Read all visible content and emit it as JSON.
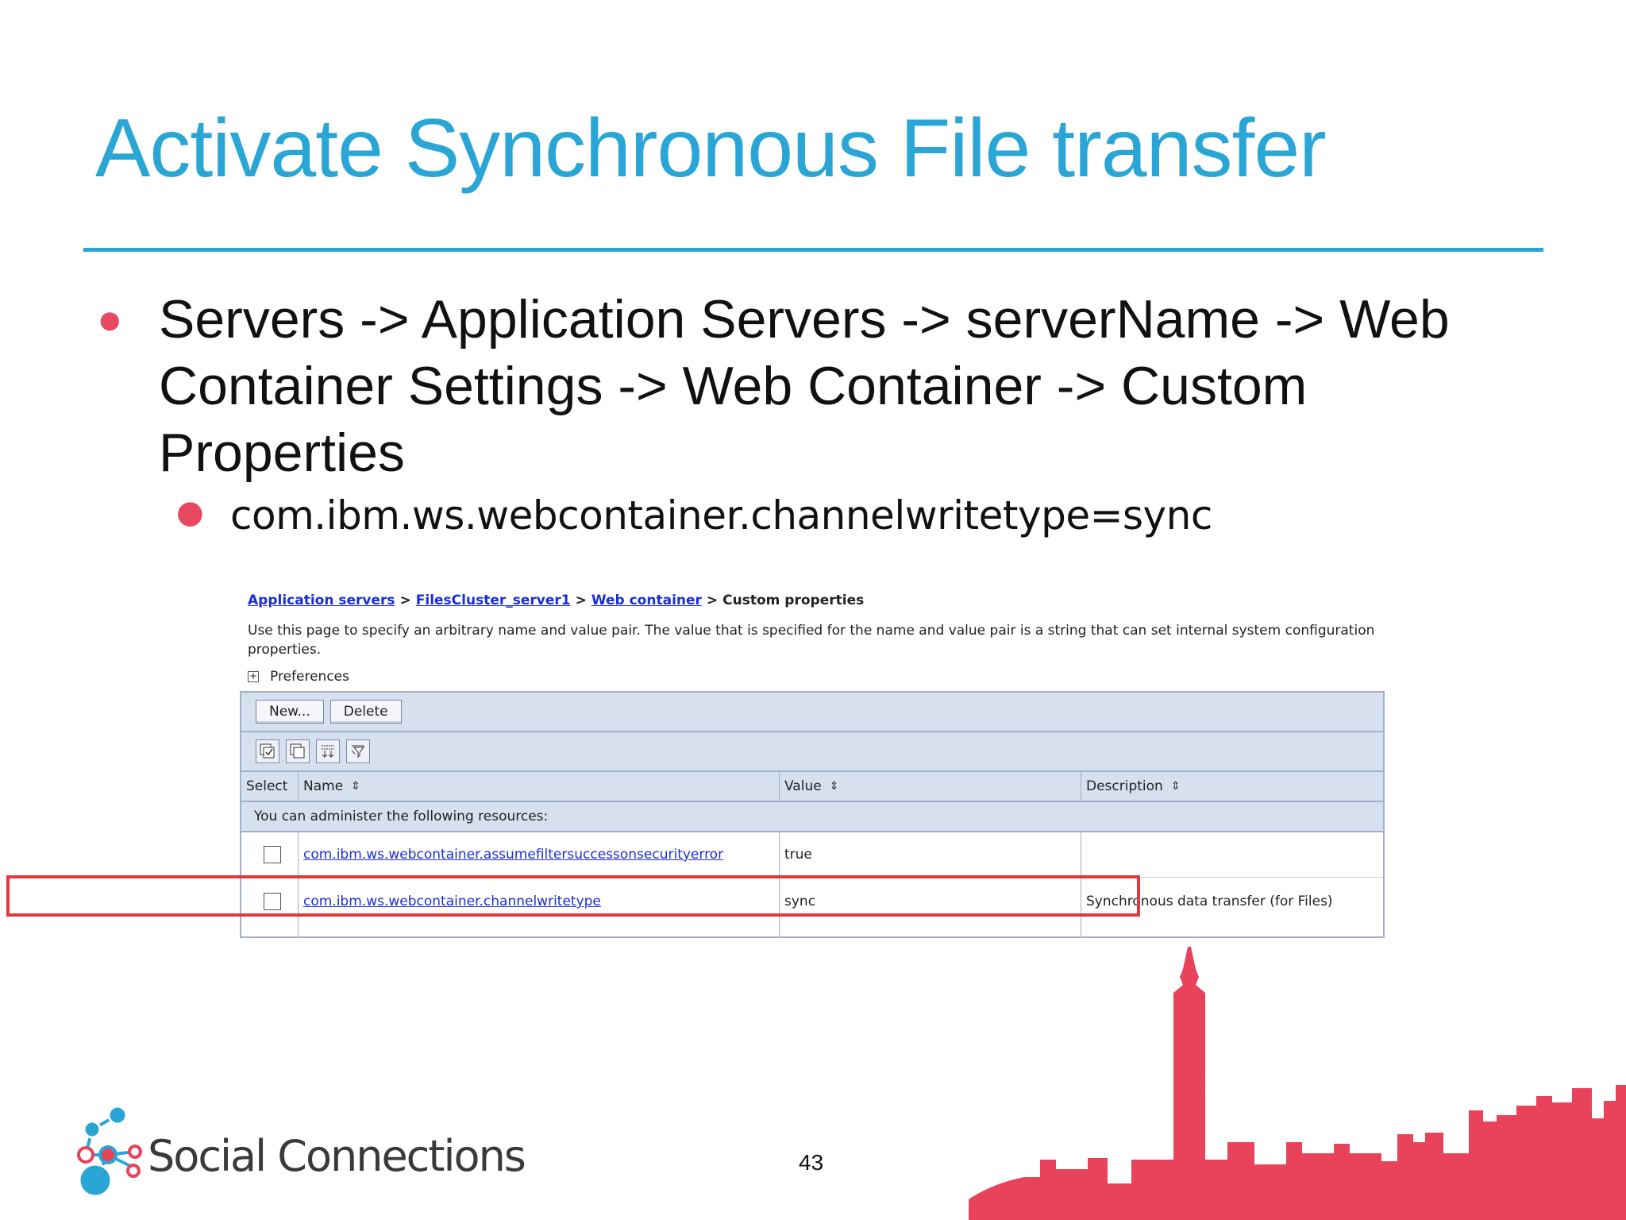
{
  "slide": {
    "title": "Activate Synchronous File transfer",
    "bullet_main": "Servers -> Application Servers -> serverName -> Web Container Settings -> Web Container -> Custom Properties",
    "bullet_sub": "com.ibm.ws.webcontainer.channelwritetype=sync",
    "page_number": "43"
  },
  "breadcrumb": {
    "items": [
      "Application servers",
      "FilesCluster_server1",
      "Web container"
    ],
    "separator": ">",
    "current": "Custom properties"
  },
  "description": "Use this page to specify an arbitrary name and value pair. The value that is specified for the name and value pair is a string that can set internal system configuration properties.",
  "preferences": {
    "toggle": "+",
    "label": "Preferences"
  },
  "toolbar": {
    "new_label": "New...",
    "delete_label": "Delete"
  },
  "table": {
    "headers": {
      "select": "Select",
      "name": "Name",
      "value": "Value",
      "description": "Description"
    },
    "sort_glyph": "⇕",
    "info": "You can administer the following resources:",
    "rows": [
      {
        "name": "com.ibm.ws.webcontainer.assumefiltersuccessonsecurityerror",
        "value": "true",
        "description": ""
      },
      {
        "name": "com.ibm.ws.webcontainer.channelwritetype",
        "value": "sync",
        "description": "Synchronous data transfer (for Files)"
      }
    ]
  },
  "footer": {
    "logo_text": "Social Connections"
  },
  "colors": {
    "title_blue": "#2aa6d6",
    "bullet_red": "#e84860",
    "skyline_red": "#e8435a",
    "link_blue": "#1a2ed8",
    "highlight_red": "#e0393e"
  }
}
